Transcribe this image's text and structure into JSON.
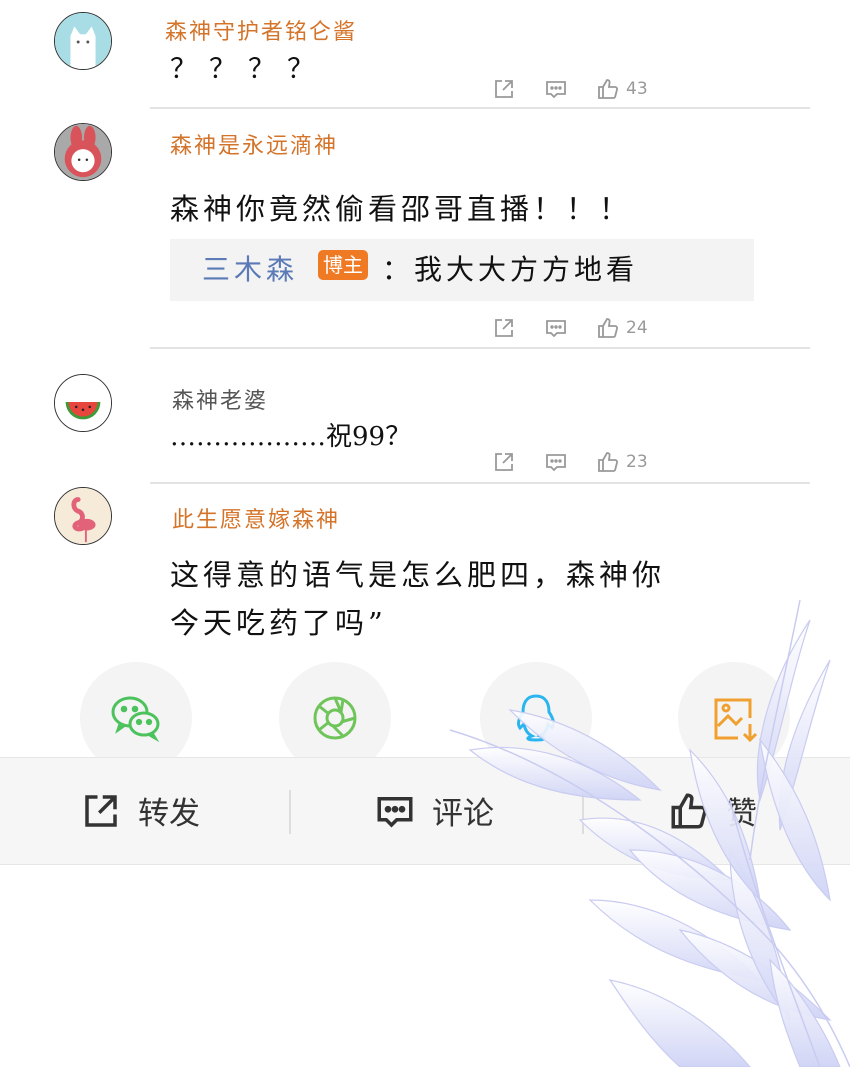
{
  "comments": [
    {
      "user": "森神守护者铭仑酱",
      "text": "？？？？",
      "likes": "43"
    },
    {
      "user": "森神是永远滴神",
      "text": "森神你竟然偷看邵哥直播！！！",
      "reply": {
        "user": "三木森",
        "badge": "博主",
        "text": "：我大大方方地看"
      },
      "likes": "24"
    },
    {
      "user": "森神老婆",
      "text": "………………祝99？",
      "likes": "23"
    },
    {
      "user": "此生愿意嫁森神",
      "text_line1": "这得意的语气是怎么肥四，森神你",
      "text_line2": "今天吃药了吗”"
    }
  ],
  "share_targets": [
    "wechat-icon",
    "moments-icon",
    "qq-icon",
    "save-image-icon"
  ],
  "bottom_bar": {
    "repost": "转发",
    "comment": "评论",
    "like": "赞"
  },
  "colors": {
    "username_orange": "#d4742a",
    "reply_blue": "#5b7ab6",
    "badge_orange": "#f07a24",
    "wechat_green": "#4cc25d",
    "qq_blue": "#2bb5f0",
    "save_orange": "#f0a030"
  }
}
